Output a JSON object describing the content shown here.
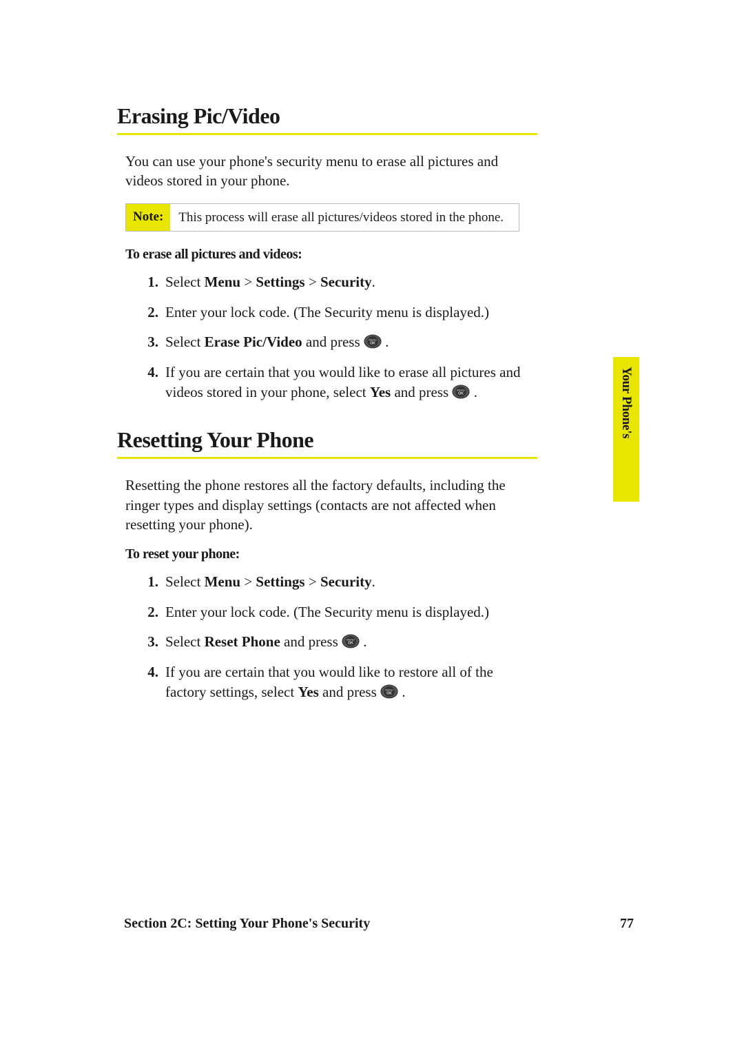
{
  "sections": {
    "erase": {
      "heading": "Erasing Pic/Video",
      "intro": "You can use your phone's security menu to erase all pictures and videos stored in your phone.",
      "note_label": "Note:",
      "note_text": "This process will erase all pictures/videos stored in the phone.",
      "instr_title": "To erase all pictures and videos:",
      "steps": {
        "s1_pre": "Select ",
        "s1_b1": "Menu",
        "s1_b2": "Settings",
        "s1_b3": "Security",
        "s2": "Enter your lock code. (The Security menu is displayed.)",
        "s3_pre": "Select ",
        "s3_bold": "Erase Pic/Video",
        "s3_mid": " and press ",
        "s4_pre": "If you are certain that you would like to erase all pictures and videos stored in your phone, select ",
        "s4_bold": "Yes",
        "s4_mid": " and press "
      }
    },
    "reset": {
      "heading": "Resetting Your Phone",
      "intro": "Resetting the phone restores all the factory defaults, including the ringer types and display settings (contacts are not affected when resetting your phone).",
      "instr_title": "To reset your phone:",
      "steps": {
        "s1_pre": "Select ",
        "s1_b1": "Menu",
        "s1_b2": "Settings",
        "s1_b3": "Security",
        "s2": "Enter your lock code. (The Security menu is displayed.)",
        "s3_pre": "Select ",
        "s3_bold": "Reset Phone",
        "s3_mid": " and press ",
        "s4_pre": "If you are certain that you would like to restore all of the factory settings, select ",
        "s4_bold": "Yes",
        "s4_mid": " and press "
      }
    }
  },
  "side_tab": "Your Phone's",
  "footer": {
    "section": "Section 2C: Setting Your Phone's Security",
    "page": "77"
  },
  "separator": " > "
}
